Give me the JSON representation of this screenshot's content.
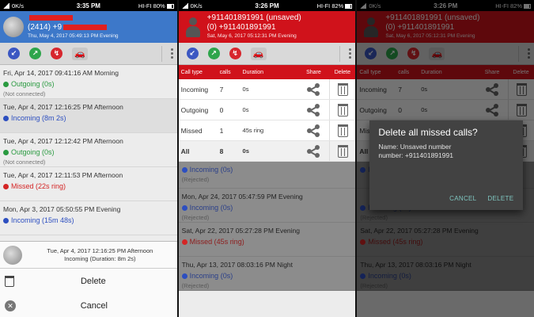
{
  "screens": [
    {
      "status": {
        "carrier": "0K/s",
        "time": "3:35 PM",
        "right": "HI-FI 80%"
      },
      "header": {
        "line1": "+91…",
        "number_prefix": "(2414) +9",
        "subtitle": "Thu, May 4, 2017  05:49:13 PM  Evening"
      },
      "entries": [
        {
          "date": "Fri, Apr 14, 2017  09:41:16 AM  Morning",
          "kind": "Outgoing (0s)",
          "type": "out",
          "sub": "(Not connected)"
        },
        {
          "date": "Tue, Apr 4, 2017  12:16:25 PM  Afternoon",
          "kind": "Incoming (8m 2s)",
          "type": "in",
          "sub": ""
        },
        {
          "date": "Tue, Apr 4, 2017  12:12:42 PM  Afternoon",
          "kind": "Outgoing (0s)",
          "type": "out",
          "sub": "(Not connected)"
        },
        {
          "date": "Tue, Apr 4, 2017  12:11:53 PM  Afternoon",
          "kind": "Missed (22s ring)",
          "type": "miss",
          "sub": ""
        },
        {
          "date": "Mon, Apr 3, 2017  05:50:55 PM  Evening",
          "kind": "Incoming (15m 48s)",
          "type": "in",
          "sub": ""
        }
      ],
      "sheet": {
        "contact_line1": "Tue, Apr 4, 2017  12:16:25 PM  Afternoon",
        "contact_line2": "Incoming (Duration: 8m 2s)",
        "delete_label": "Delete",
        "cancel_label": "Cancel"
      }
    },
    {
      "status": {
        "carrier": "0K/s",
        "time": "3:26 PM",
        "right": "HI-FI 82%"
      },
      "header": {
        "line1": "+911401891991 (unsaved)",
        "line2": "(0) +911401891991",
        "subtitle": "Sat, May 6, 2017  05:12:31 PM  Evening"
      },
      "table": {
        "headers": [
          "Call type",
          "calls",
          "Duration",
          "Share",
          "Delete"
        ],
        "rows": [
          {
            "type": "Incoming",
            "calls": "7",
            "duration": "0s"
          },
          {
            "type": "Outgoing",
            "calls": "0",
            "duration": "0s"
          },
          {
            "type": "Missed",
            "calls": "1",
            "duration": "45s ring"
          },
          {
            "type": "All",
            "calls": "8",
            "duration": "0s"
          }
        ]
      },
      "entries": [
        {
          "date": "",
          "kind": "Incoming (0s)",
          "type": "in",
          "sub": "(Rejected)"
        },
        {
          "date": "Mon, Apr 24, 2017  05:47:59 PM  Evening",
          "kind": "Incoming (0s)",
          "type": "in",
          "sub": "(Rejected)"
        },
        {
          "date": "Sat, Apr 22, 2017  05:27:28 PM  Evening",
          "kind": "Missed (45s ring)",
          "type": "miss",
          "sub": ""
        },
        {
          "date": "Thu, Apr 13, 2017  08:03:16 PM  Night",
          "kind": "Incoming (0s)",
          "type": "in",
          "sub": "(Rejected)"
        }
      ]
    },
    {
      "status": {
        "carrier": "0K/s",
        "time": "3:26 PM",
        "right": "HI-FI 82%"
      },
      "header": {
        "line1": "+911401891991 (unsaved)",
        "line2": "(0) +911401891991",
        "subtitle": "Sat, May 6, 2017  05:12:31 PM  Evening"
      },
      "table": {
        "headers": [
          "Call type",
          "calls",
          "Duration",
          "Share",
          "Delete"
        ],
        "rows": [
          {
            "type": "Incoming",
            "calls": "7",
            "duration": "0s"
          },
          {
            "type": "Outgoing",
            "calls": "0",
            "duration": "0s"
          },
          {
            "type": "Missed",
            "calls": "1",
            "duration": ""
          },
          {
            "type": "All",
            "calls": "",
            "duration": ""
          }
        ]
      },
      "entries": [
        {
          "date": "",
          "kind": "Incoming (0s)",
          "type": "in",
          "sub": ""
        },
        {
          "date": "",
          "kind": "Incoming (0s)",
          "type": "in",
          "sub": "(Rejected)"
        },
        {
          "date": "Sat, Apr 22, 2017  05:27:28 PM  Evening",
          "kind": "Missed (45s ring)",
          "type": "miss",
          "sub": ""
        },
        {
          "date": "Thu, Apr 13, 2017  08:03:16 PM  Night",
          "kind": "Incoming (0s)",
          "type": "in",
          "sub": "(Rejected)"
        }
      ],
      "dialog": {
        "title": "Delete all missed calls?",
        "body_line1": "Name: Unsaved number",
        "body_line2": "number: +911401891991",
        "cancel": "CANCEL",
        "confirm": "DELETE"
      }
    }
  ],
  "icons": [
    "incoming-filter-icon",
    "outgoing-filter-icon",
    "missed-filter-icon",
    "car-icon",
    "overflow-menu-icon",
    "share-icon",
    "trash-icon",
    "close-icon"
  ],
  "colors": {
    "blue_header": "#3d78c9",
    "red_header": "#d0121b",
    "incoming": "#2d4fc0",
    "outgoing": "#2a9a40",
    "missed": "#d42525"
  }
}
